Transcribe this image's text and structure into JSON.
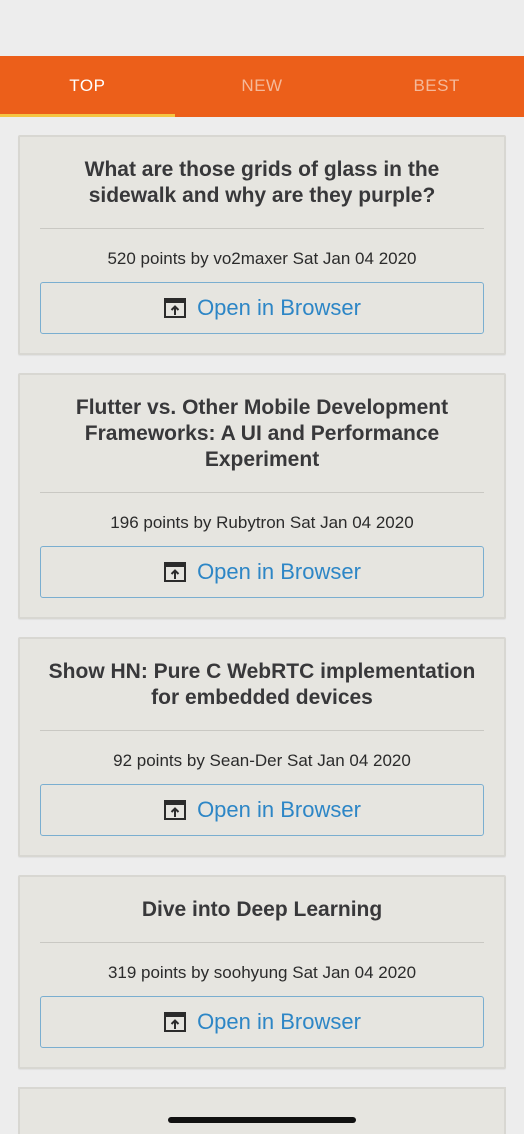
{
  "tabs": [
    {
      "label": "TOP"
    },
    {
      "label": "NEW"
    },
    {
      "label": "BEST"
    }
  ],
  "active_tab": "TOP",
  "open_button_label": "Open in Browser",
  "stories": [
    {
      "title": "What are those grids of glass in the sidewalk and why are they purple?",
      "points": "520 points by vo2maxer Sat Jan 04 2020"
    },
    {
      "title": "Flutter vs. Other Mobile Development Frameworks: A UI and Performance Experiment",
      "points": "196 points by Rubytron Sat Jan 04 2020"
    },
    {
      "title": "Show HN: Pure C WebRTC implementation for embedded devices",
      "points": "92 points by Sean-Der Sat Jan 04 2020"
    },
    {
      "title": "Dive into Deep Learning",
      "points": "319 points by soohyung Sat Jan 04 2020"
    }
  ],
  "colors": {
    "tab_bar": "#ec5f1a",
    "tab_indicator": "#f5c542",
    "link_blue": "#2d86c6",
    "card_bg": "#e6e5e0"
  }
}
